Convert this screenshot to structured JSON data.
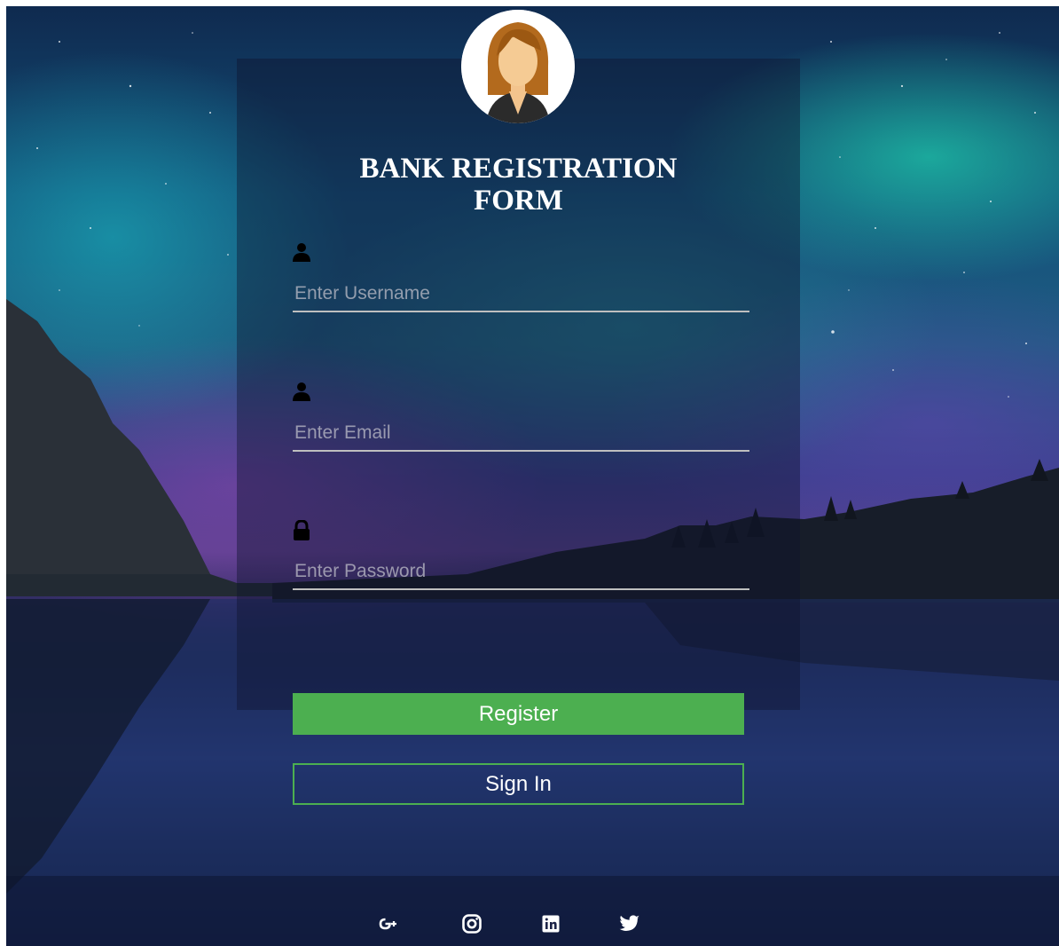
{
  "form": {
    "title_line1": "BANK REGISTRATION",
    "title_line2": "FORM",
    "username": {
      "placeholder": "Enter Username",
      "value": "",
      "icon": "user-icon"
    },
    "email": {
      "placeholder": "Enter Email",
      "value": "",
      "icon": "user-icon"
    },
    "password": {
      "placeholder": "Enter Password",
      "value": "",
      "icon": "lock-icon"
    },
    "register_label": "Register",
    "signin_label": "Sign In"
  },
  "social": [
    {
      "icon": "google-plus-icon"
    },
    {
      "icon": "instagram-icon"
    },
    {
      "icon": "linkedin-icon"
    },
    {
      "icon": "twitter-icon"
    }
  ],
  "colors": {
    "accent": "#4caf50",
    "text": "#ffffff",
    "underline": "#bfbfbf"
  }
}
